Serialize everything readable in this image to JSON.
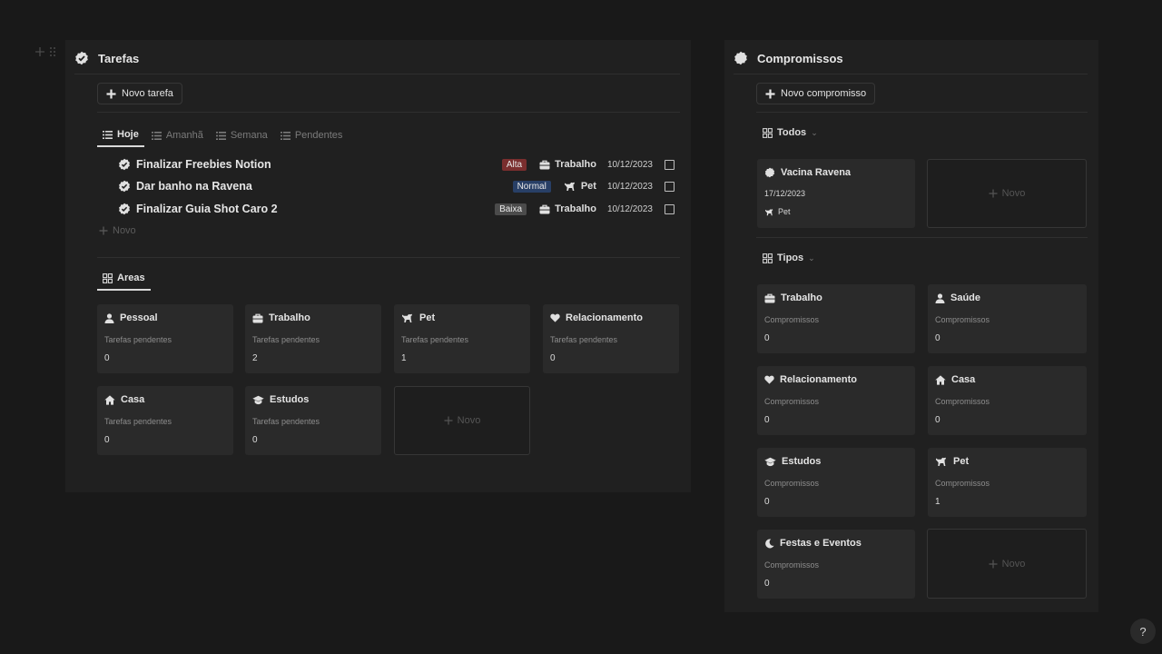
{
  "tarefas": {
    "title": "Tarefas",
    "new_button": "Novo tarefa",
    "tabs": [
      "Hoje",
      "Amanhã",
      "Semana",
      "Pendentes"
    ],
    "tasks": [
      {
        "title": "Finalizar Freebies Notion",
        "priority": "Alta",
        "priority_color": "#7a2e2e",
        "area": "Trabalho",
        "date": "10/12/2023"
      },
      {
        "title": "Dar banho na Ravena",
        "priority": "Normal",
        "priority_color": "#283f66",
        "area": "Pet",
        "date": "10/12/2023"
      },
      {
        "title": "Finalizar Guia Shot Caro 2",
        "priority": "Baixa",
        "priority_color": "#4b4b4b",
        "area": "Trabalho",
        "date": "10/12/2023"
      }
    ],
    "add_label": "Novo",
    "areas_tab": "Areas",
    "areas": [
      {
        "name": "Pessoal",
        "icon": "person-icon",
        "sub": "Tarefas pendentes",
        "count": "0"
      },
      {
        "name": "Trabalho",
        "icon": "briefcase-icon",
        "sub": "Tarefas pendentes",
        "count": "2"
      },
      {
        "name": "Pet",
        "icon": "dog-icon",
        "sub": "Tarefas pendentes",
        "count": "1"
      },
      {
        "name": "Relacionamento",
        "icon": "heart-icon",
        "sub": "Tarefas pendentes",
        "count": "0"
      },
      {
        "name": "Casa",
        "icon": "house-icon",
        "sub": "Tarefas pendentes",
        "count": "0"
      },
      {
        "name": "Estudos",
        "icon": "graduation-cap-icon",
        "sub": "Tarefas pendentes",
        "count": "0"
      }
    ],
    "areas_new": "Novo"
  },
  "compromissos": {
    "title": "Compromissos",
    "new_button": "Novo compromisso",
    "view_todos": "Todos",
    "event": {
      "name": "Vacina Ravena",
      "date": "17/12/2023",
      "area": "Pet"
    },
    "todos_new": "Novo",
    "view_tipos": "Tipos",
    "tipos": [
      {
        "name": "Trabalho",
        "icon": "briefcase-icon",
        "sub": "Compromissos",
        "count": "0"
      },
      {
        "name": "Saúde",
        "icon": "person-icon",
        "sub": "Compromissos",
        "count": "0"
      },
      {
        "name": "Relacionamento",
        "icon": "heart-icon",
        "sub": "Compromissos",
        "count": "0"
      },
      {
        "name": "Casa",
        "icon": "house-icon",
        "sub": "Compromissos",
        "count": "0"
      },
      {
        "name": "Estudos",
        "icon": "graduation-cap-icon",
        "sub": "Compromissos",
        "count": "0"
      },
      {
        "name": "Pet",
        "icon": "dog-icon",
        "sub": "Compromissos",
        "count": "1"
      },
      {
        "name": "Festas e Eventos",
        "icon": "moon-icon",
        "sub": "Compromissos",
        "count": "0"
      }
    ],
    "tipos_new": "Novo"
  },
  "help": "?"
}
